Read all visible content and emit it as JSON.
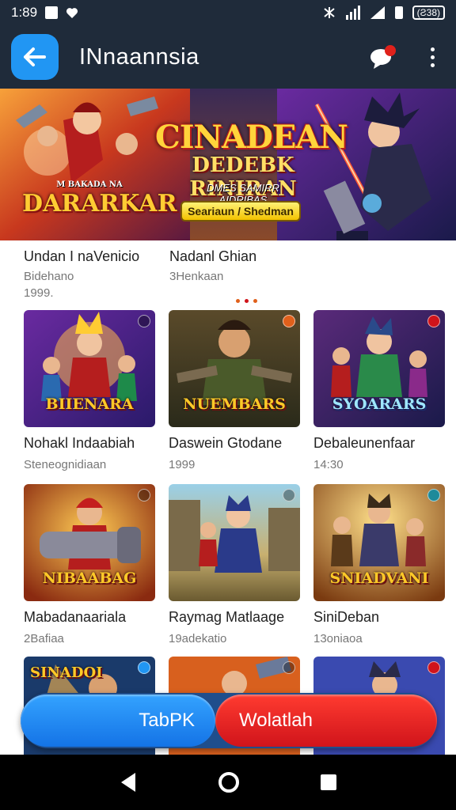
{
  "status_bar": {
    "time": "1:89",
    "battery": "(Ƨ38)"
  },
  "app_bar": {
    "title": "INnaannsia"
  },
  "banner": {
    "title": "CINADEAN",
    "subtitle": "DEDEBK RINIRAN",
    "small_text": "DMES SAMIRR AIDRIBAS",
    "badge": "Seariaun / Shedman",
    "left_logo": "DARARKAR",
    "left_logo_small": "M BAKADA NA"
  },
  "top_items": [
    {
      "title": "Undan I naVenicio",
      "sub": "Bidehano",
      "sub2": "1999."
    },
    {
      "title": "Nadanl Ghian",
      "sub": "3Henkaan"
    }
  ],
  "grid": [
    {
      "title": "Nohakl Indaabiah",
      "sub": "Steneognidiaan",
      "logo": "BIIENARA"
    },
    {
      "title": "Daswein Gtodane",
      "sub": "1999",
      "logo": "NUEMBARS"
    },
    {
      "title": "Debaleunenfaar",
      "sub": "14:30",
      "logo": "SYOARARS"
    },
    {
      "title": "Mabadanaariala",
      "sub": "2Bafiaa",
      "logo": "NIBAABAG"
    },
    {
      "title": "Raymag Matlaage",
      "sub": "19adekatio",
      "logo": ""
    },
    {
      "title": "SiniDeban",
      "sub": "13oniaoa",
      "logo": "SNIADVANI"
    },
    {
      "title": "",
      "sub": "",
      "logo": "SINADOI"
    },
    {
      "title": "",
      "sub": "",
      "logo": ""
    },
    {
      "title": "",
      "sub": "",
      "logo": ""
    }
  ],
  "buttons": {
    "primary": "TabPK",
    "secondary": "Wolatlah"
  },
  "icons": {
    "back": "arrow-left-icon",
    "chat": "chat-bubble-icon",
    "more": "more-vertical-icon",
    "nav_back": "triangle-back-icon",
    "nav_home": "circle-home-icon",
    "nav_recent": "square-recent-icon"
  },
  "colors": {
    "app_bar": "#1f2b3a",
    "accent_blue": "#2196f3",
    "accent_red": "#e0211b"
  }
}
